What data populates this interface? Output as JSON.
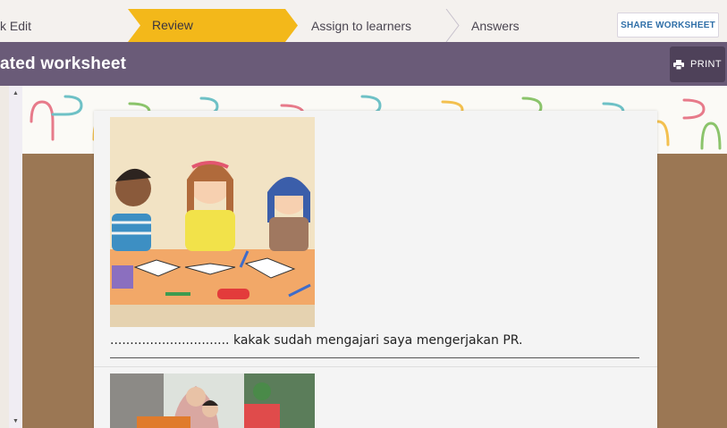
{
  "steps": {
    "edit_label": "k Edit",
    "review_label": "Review",
    "assign_label": "Assign to learners",
    "answers_label": "Answers",
    "share_label": "SHARE WORKSHEET"
  },
  "header": {
    "title": "ated worksheet",
    "print_label": "PRINT"
  },
  "worksheet": {
    "question1": {
      "blank": "..............................",
      "text": "kakak sudah mengajari saya mengerjakan PR."
    }
  },
  "colors": {
    "accent_step": "#f3b81a",
    "header_bar": "#6a5b78",
    "print_button": "#4e4159",
    "share_text": "#2f6fa8",
    "cork": "#9b7754"
  },
  "icons": {
    "print": "printer-icon",
    "scroll_up": "scroll-up-arrow-icon",
    "scroll_down": "scroll-down-arrow-icon"
  }
}
